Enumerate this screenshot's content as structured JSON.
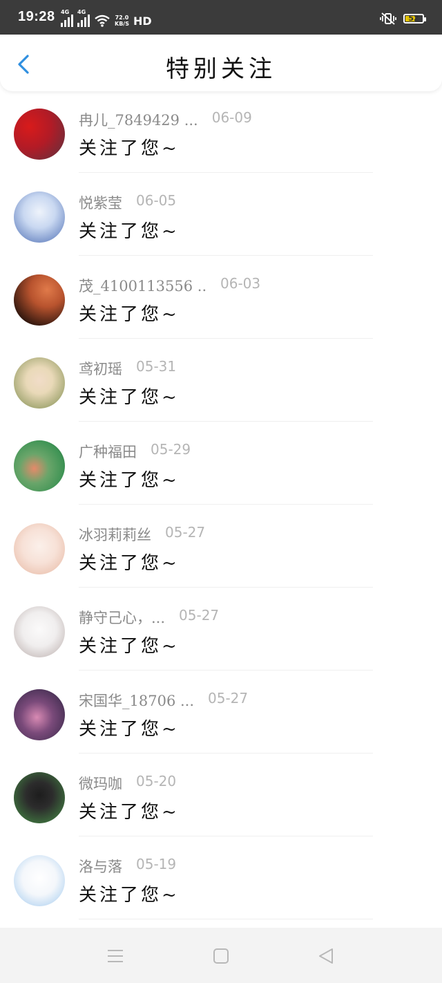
{
  "status_bar": {
    "time": "19:28",
    "signal1_label": "4G",
    "signal2_label": "4G",
    "net_speed_value": "72.0",
    "net_speed_unit": "KB/S",
    "hd_label": "HD",
    "battery_level": "52"
  },
  "header": {
    "title": "特别关注"
  },
  "items": [
    {
      "name": "冉儿_7849429 ...",
      "date": "06-09",
      "message": "关注了您~",
      "avatar_colors": [
        "#d81b1b",
        "#5a3340"
      ]
    },
    {
      "name": "悦紫莹",
      "date": "06-05",
      "message": "关注了您~",
      "avatar_colors": [
        "#c9d8f1",
        "#4c6db3"
      ]
    },
    {
      "name": "茂_4100113556 ...",
      "date": "06-03",
      "message": "关注了您~",
      "avatar_colors": [
        "#b8532e",
        "#1c0e0a"
      ]
    },
    {
      "name": "鸢初瑶",
      "date": "05-31",
      "message": "关注了您~",
      "avatar_colors": [
        "#e9d9b8",
        "#7b8a4b"
      ]
    },
    {
      "name": "广种福田",
      "date": "05-29",
      "message": "关注了您~",
      "avatar_colors": [
        "#3f9455",
        "#e58a6a"
      ]
    },
    {
      "name": "冰羽莉莉丝",
      "date": "05-27",
      "message": "关注了您~",
      "avatar_colors": [
        "#f7e1d7",
        "#e6b6a0"
      ]
    },
    {
      "name": "静守己心，...",
      "date": "05-27",
      "message": "关注了您~",
      "avatar_colors": [
        "#f0eeee",
        "#b7aaa8"
      ]
    },
    {
      "name": "宋国华_18706 ...",
      "date": "05-27",
      "message": "关注了您~",
      "avatar_colors": [
        "#2b2240",
        "#d88ab3"
      ]
    },
    {
      "name": "微玛咖",
      "date": "05-20",
      "message": "关注了您~",
      "avatar_colors": [
        "#3c6a3c",
        "#1d1d1d"
      ]
    },
    {
      "name": "洛与落",
      "date": "05-19",
      "message": "关注了您~",
      "avatar_colors": [
        "#f4f7fb",
        "#9ec8ee"
      ]
    }
  ],
  "colors": {
    "accent": "#2f8fe0",
    "status_bar_bg": "#3b3b3b",
    "name_text": "#8a8a8a",
    "date_text": "#b5b5b5",
    "message_text": "#111111"
  },
  "icons": {
    "back": "chevron-left-icon",
    "menu": "menu-icon",
    "home": "square-icon",
    "nav_back": "triangle-left-icon",
    "mute": "vibrate-mute-icon",
    "wifi": "wifi-icon"
  }
}
